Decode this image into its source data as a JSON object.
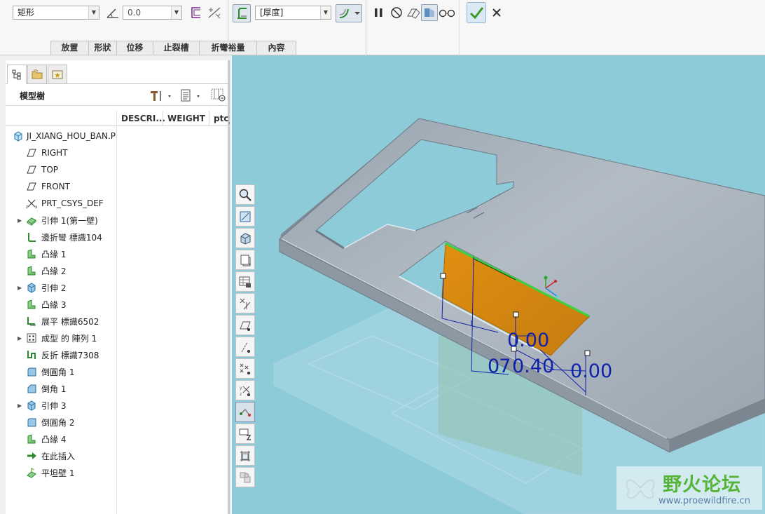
{
  "dashboard": {
    "shape_select": "矩形",
    "angle_value": "0.0",
    "thickness_select": "[厚度]",
    "tabs": [
      {
        "label": "放置"
      },
      {
        "label": "形狀"
      },
      {
        "label": "位移"
      },
      {
        "label": "止裂槽"
      },
      {
        "label": "折彎裕量"
      },
      {
        "label": "內容"
      }
    ]
  },
  "left_panel": {
    "title": "模型樹",
    "columns": [
      "DESCRI...",
      "WEIGHT",
      "ptc_"
    ],
    "tree": [
      {
        "label": "JI_XIANG_HOU_BAN.P",
        "icon": "part-icon",
        "expandable": false
      },
      {
        "label": "RIGHT",
        "icon": "datum-plane-icon",
        "expandable": false
      },
      {
        "label": "TOP",
        "icon": "datum-plane-icon",
        "expandable": false
      },
      {
        "label": "FRONT",
        "icon": "datum-plane-icon",
        "expandable": false
      },
      {
        "label": "PRT_CSYS_DEF",
        "icon": "csys-icon",
        "expandable": false
      },
      {
        "label": "引伸 1(第一壁)",
        "icon": "extrude-wall-icon",
        "expandable": true
      },
      {
        "label": "邊折彎 標識104",
        "icon": "edge-bend-icon",
        "expandable": false
      },
      {
        "label": "凸緣 1",
        "icon": "flange-icon",
        "expandable": false
      },
      {
        "label": "凸緣 2",
        "icon": "flange-icon",
        "expandable": false
      },
      {
        "label": "引伸 2",
        "icon": "extrude-icon",
        "expandable": true
      },
      {
        "label": "凸緣 3",
        "icon": "flange-icon",
        "expandable": false
      },
      {
        "label": "展平 標識6502",
        "icon": "unbend-icon",
        "expandable": false
      },
      {
        "label": "成型 的 陣列 1",
        "icon": "pattern-icon",
        "expandable": true
      },
      {
        "label": "反折 標識7308",
        "icon": "bend-back-icon",
        "expandable": false
      },
      {
        "label": "倒圓角 1",
        "icon": "round-icon",
        "expandable": false
      },
      {
        "label": "倒角 1",
        "icon": "chamfer-icon",
        "expandable": false
      },
      {
        "label": "引伸 3",
        "icon": "extrude-icon",
        "expandable": true
      },
      {
        "label": "倒圓角 2",
        "icon": "round-icon",
        "expandable": false
      },
      {
        "label": "凸緣 4",
        "icon": "flange-icon",
        "expandable": false
      },
      {
        "label": "在此插入",
        "icon": "insert-here-arrow-icon",
        "expandable": false
      },
      {
        "label": "平坦壁 1",
        "icon": "flat-wall-icon",
        "expandable": false
      }
    ]
  },
  "viewport": {
    "dimensions": {
      "d1": "0.00",
      "d2": "0.40",
      "d3": "0.00"
    },
    "watermark": {
      "title": "野火论坛",
      "url": "www.proewildfire.cn"
    }
  },
  "colors": {
    "viewport_bg": "#8ecbd9",
    "part_gray": "#a4afb9",
    "wall_orange": "#d68a10",
    "dimension_blue": "#1122aa",
    "confirm_green": "#3a9a2a"
  }
}
